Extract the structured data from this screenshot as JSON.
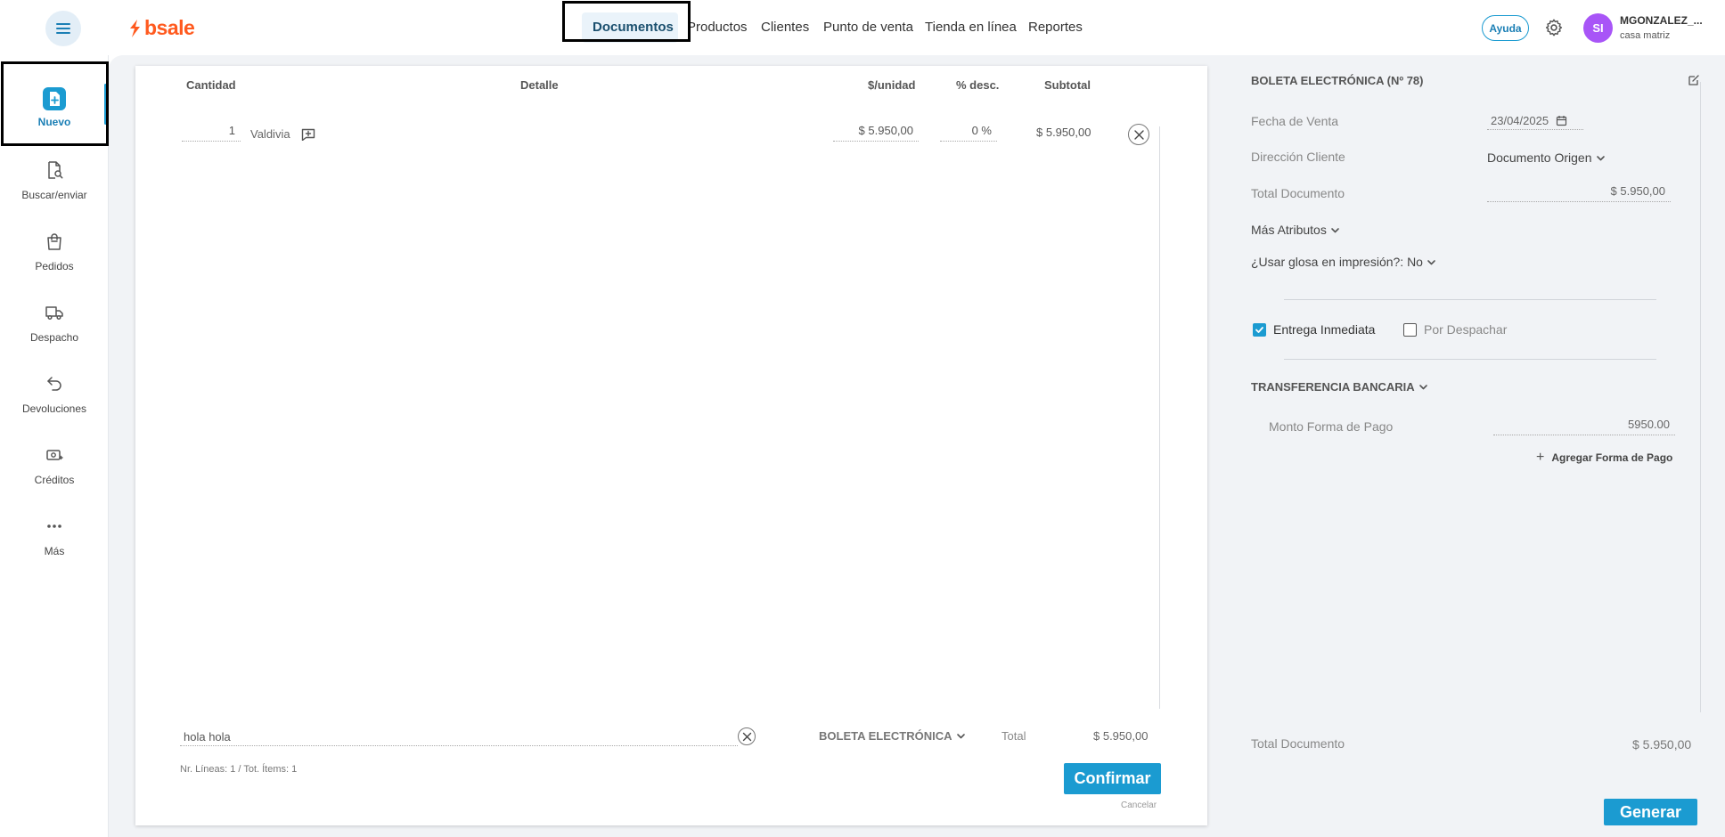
{
  "brand": {
    "logo_text": "bsale",
    "color": "#ff5a1f"
  },
  "accent_color": "#1b9bd1",
  "nav": {
    "items": [
      "Documentos",
      "Productos",
      "Clientes",
      "Punto de venta",
      "Tienda en línea",
      "Reportes"
    ],
    "active": "Documentos"
  },
  "header": {
    "help_label": "Ayuda",
    "settings_icon": "gear-icon",
    "user_initials": "SI",
    "user_name": "MGONZALEZ_...",
    "user_branch": "casa matriz"
  },
  "sidebar": {
    "items": [
      {
        "label": "Nuevo",
        "icon": "new-document-icon",
        "active": true
      },
      {
        "label": "Buscar/enviar",
        "icon": "search-document-icon"
      },
      {
        "label": "Pedidos",
        "icon": "shopping-bag-icon"
      },
      {
        "label": "Despacho",
        "icon": "truck-icon"
      },
      {
        "label": "Devoluciones",
        "icon": "return-arrow-icon"
      },
      {
        "label": "Créditos",
        "icon": "credit-icon"
      },
      {
        "label": "Más",
        "icon": "more-dots-icon"
      }
    ]
  },
  "document": {
    "columns": {
      "quantity": "Cantidad",
      "detail": "Detalle",
      "unit_price": "$/unidad",
      "discount": "% desc.",
      "subtotal": "Subtotal"
    },
    "lines": [
      {
        "quantity": "1",
        "detail": "Valdivia",
        "unit_price": "$ 5.950,00",
        "discount": "0 %",
        "subtotal": "$ 5.950,00"
      }
    ],
    "comment": "hola hola",
    "document_type": "BOLETA ELECTRÓNICA",
    "total_label": "Total",
    "total_value": "$ 5.950,00",
    "counts": "Nr. Líneas: 1 / Tot. Ítems: 1",
    "confirm_label": "Confirmar",
    "cancel_label": "Cancelar"
  },
  "right_panel": {
    "title": "BOLETA ELECTRÓNICA (Nº 78)",
    "sale_date_label": "Fecha de Venta",
    "sale_date": "23/04/2025",
    "client_address_label": "Dirección Cliente",
    "client_address_value": "Documento Origen",
    "doc_total_label": "Total Documento",
    "doc_total_value": "$ 5.950,00",
    "more_attributes": "Más Atributos",
    "use_gloss": "¿Usar glosa en impresión?: No",
    "immediate_delivery": "Entrega Inmediata",
    "immediate_delivery_checked": true,
    "to_dispatch": "Por Despachar",
    "to_dispatch_checked": false,
    "payment_method": "TRANSFERENCIA BANCARIA",
    "payment_amount_label": "Monto Forma de Pago",
    "payment_amount_value": "5950.00",
    "add_payment_label": "Agregar Forma de Pago",
    "footer_total_label": "Total Documento",
    "footer_total_value": "$ 5.950,00",
    "generate_label": "Generar"
  }
}
